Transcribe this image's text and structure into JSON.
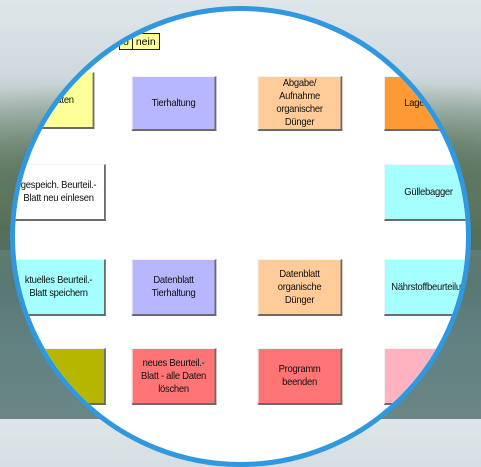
{
  "toggle": {
    "ja_partial": "o",
    "nein": "nein"
  },
  "tiles": {
    "stammdaten": "ammdaten",
    "tierhaltung": "Tierhaltung",
    "abgabe_aufnahme": "Abgabe/ Aufnahme organischer Dünger",
    "lagerkapazitaet": "Lagerkapazi",
    "gespeich": "gespeich. Beurteil.-Blatt neu einlesen",
    "guellebagger": "Güllebagger",
    "aktuelles": "ktuelles Beurteil.-Blatt speichern",
    "datenblatt_tierhaltung": "Datenblatt Tierhaltung",
    "datenblatt_organische": "Datenblatt organische Dünger",
    "naehrstoff": "Nährstoffbeurteilun",
    "neues": "neues Beurteil.-Blatt - alle Daten löschen",
    "beenden": "Programm beenden"
  },
  "colors": {
    "yellow": "#ffff99",
    "lavender": "#b7b7ff",
    "peach": "#ffcc99",
    "orange": "#ff9933",
    "cyan": "#a6ffff",
    "olive": "#b6b600",
    "red": "#ff7575",
    "pink": "#ffb3c1",
    "ring": "#2f98de"
  }
}
